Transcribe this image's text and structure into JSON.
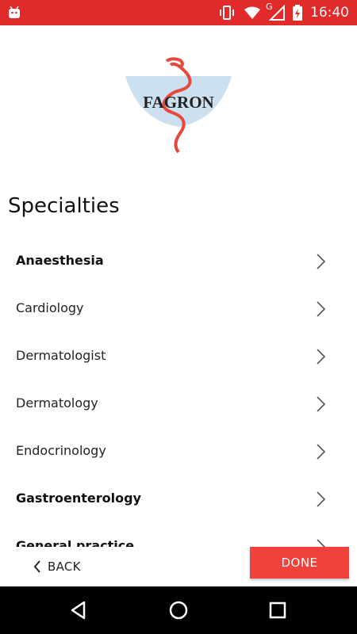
{
  "status_bar": {
    "time": "16:40",
    "network_letter": "G",
    "icons": [
      "android-icon",
      "vibrate-icon",
      "wifi-icon",
      "signal-icon",
      "battery-charging-icon"
    ],
    "background_color": "#e12a2a"
  },
  "logo": {
    "text": "FAGRON",
    "icon": "caduceus-snake-logo"
  },
  "page": {
    "title": "Specialties"
  },
  "specialties": [
    {
      "label": "Anaesthesia",
      "bold": true
    },
    {
      "label": "Cardiology",
      "bold": false
    },
    {
      "label": "Dermatologist",
      "bold": false
    },
    {
      "label": "Dermatology",
      "bold": false
    },
    {
      "label": "Endocrinology",
      "bold": false
    },
    {
      "label": "Gastroenterology",
      "bold": true
    },
    {
      "label": "General practice",
      "bold": true
    }
  ],
  "footer": {
    "back_label": "BACK",
    "done_label": "DONE",
    "done_color": "#f0423a"
  },
  "nav_bar": {
    "icons": [
      "back-triangle-icon",
      "home-circle-icon",
      "recents-square-icon"
    ]
  }
}
